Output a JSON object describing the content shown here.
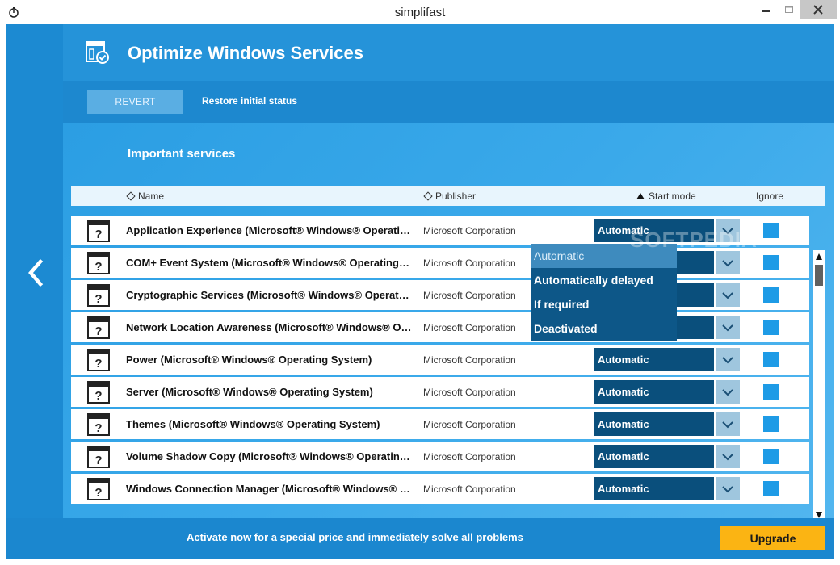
{
  "window": {
    "title": "simplifast"
  },
  "header": {
    "title": "Optimize Windows Services"
  },
  "toolbar": {
    "revert_label": "REVERT",
    "restore_label": "Restore initial status"
  },
  "section": {
    "title": "Important services"
  },
  "columns": {
    "name": "Name",
    "publisher": "Publisher",
    "start_mode": "Start mode",
    "ignore": "Ignore"
  },
  "services": [
    {
      "name": "Application Experience (Microsoft® Windows® Operating System)",
      "publisher": "Microsoft Corporation",
      "mode": "Automatic"
    },
    {
      "name": "COM+ Event System (Microsoft® Windows® Operating System)",
      "publisher": "Microsoft Corporation",
      "mode": "Automatic"
    },
    {
      "name": "Cryptographic Services (Microsoft® Windows® Operating System)",
      "publisher": "Microsoft Corporation",
      "mode": "Automatic"
    },
    {
      "name": "Network Location Awareness (Microsoft® Windows® Operating System)",
      "publisher": "Microsoft Corporation",
      "mode": "Automatic"
    },
    {
      "name": "Power (Microsoft® Windows® Operating System)",
      "publisher": "Microsoft Corporation",
      "mode": "Automatic"
    },
    {
      "name": "Server (Microsoft® Windows® Operating System)",
      "publisher": "Microsoft Corporation",
      "mode": "Automatic"
    },
    {
      "name": "Themes (Microsoft® Windows® Operating System)",
      "publisher": "Microsoft Corporation",
      "mode": "Automatic"
    },
    {
      "name": "Volume Shadow Copy (Microsoft® Windows® Operating System)",
      "publisher": "Microsoft Corporation",
      "mode": "Automatic"
    },
    {
      "name": "Windows Connection Manager (Microsoft® Windows® Operating System)",
      "publisher": "Microsoft Corporation",
      "mode": "Automatic"
    }
  ],
  "dropdown": {
    "options": [
      "Automatic",
      "Automatically delayed",
      "If required",
      "Deactivated"
    ],
    "selected": "Automatic"
  },
  "watermark": "SOFTPEDIA",
  "footer": {
    "text": "Activate now for a special price and immediately solve all problems",
    "upgrade_label": "Upgrade"
  },
  "colors": {
    "accent": "#1d88cf",
    "mode_bg": "#0a4f7c",
    "upgrade": "#fbb413",
    "checkbox": "#1e9be6"
  },
  "icons": {
    "app": "stopwatch-icon",
    "back": "chevron-left-icon",
    "service": "unknown-service-icon",
    "header": "services-settings-icon"
  }
}
